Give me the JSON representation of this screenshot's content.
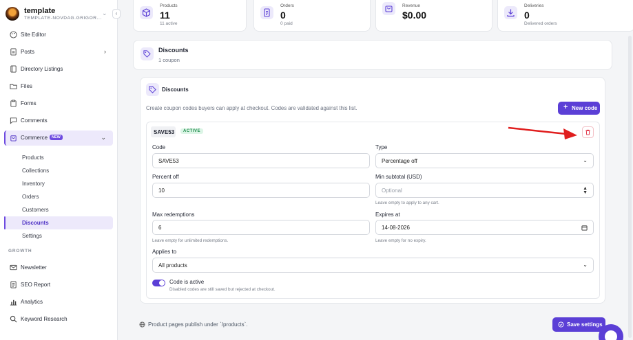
{
  "workspace": {
    "name": "template",
    "subtitle": "TEMPLATE-NOVDAG.GRIGOR..."
  },
  "sidebar": {
    "items": [
      {
        "label": "Site Editor",
        "icon": "palette-icon"
      },
      {
        "label": "Posts",
        "icon": "document-icon"
      },
      {
        "label": "Directory Listings",
        "icon": "book-icon"
      },
      {
        "label": "Files",
        "icon": "folder-icon"
      },
      {
        "label": "Forms",
        "icon": "clipboard-icon"
      },
      {
        "label": "Comments",
        "icon": "comment-icon"
      },
      {
        "label": "Commerce",
        "icon": "shopping-bag-icon",
        "badge": "NEW"
      }
    ],
    "commerce_subitems": [
      "Products",
      "Collections",
      "Inventory",
      "Orders",
      "Customers",
      "Discounts",
      "Settings"
    ],
    "growth_label": "GROWTH",
    "growth_items": [
      {
        "label": "Newsletter",
        "icon": "mail-icon"
      },
      {
        "label": "SEO Report",
        "icon": "report-icon"
      },
      {
        "label": "Analytics",
        "icon": "bar-chart-icon"
      },
      {
        "label": "Keyword Research",
        "icon": "search-icon"
      }
    ]
  },
  "stats": [
    {
      "label": "Products",
      "value": "11",
      "sub": "11 active",
      "icon": "cube-icon"
    },
    {
      "label": "Orders",
      "value": "0",
      "sub": "0 paid",
      "icon": "receipt-icon"
    },
    {
      "label": "Revenue",
      "value": "$0.00",
      "sub": "",
      "icon": "bag-icon"
    },
    {
      "label": "Deliveries",
      "value": "0",
      "sub": "Delivered orders",
      "icon": "download-icon"
    }
  ],
  "header_card": {
    "title": "Discounts",
    "subtitle": "1 coupon"
  },
  "discounts_panel": {
    "title": "Discounts",
    "description": "Create coupon codes buyers can apply at checkout. Codes are validated against this list.",
    "new_code_label": "New code"
  },
  "coupon": {
    "code_tag": "SAVE53",
    "status": "ACTIVE",
    "code_label": "Code",
    "code_value": "SAVE53",
    "type_label": "Type",
    "type_value": "Percentage off",
    "percent_label": "Percent off",
    "percent_value": "10",
    "min_label": "Min subtotal (USD)",
    "min_placeholder": "Optional",
    "min_help": "Leave empty to apply to any cart.",
    "max_label": "Max redemptions",
    "max_value": "6",
    "max_help": "Leave empty for unlimited redemptions.",
    "expires_label": "Expires at",
    "expires_value": "14-08-2026",
    "expires_help": "Leave empty for no expiry.",
    "applies_label": "Applies to",
    "applies_value": "All products",
    "active_label": "Code is active",
    "active_help": "Disabled codes are still saved but rejected at checkout.",
    "active_on": true
  },
  "footer": {
    "note": "Product pages publish under `/products`.",
    "save_label": "Save settings"
  },
  "colors": {
    "accent": "#5b3fd6",
    "danger": "#e0253a",
    "active_badge_bg": "#dcf5e6",
    "active_badge_text": "#1d8a4a"
  }
}
